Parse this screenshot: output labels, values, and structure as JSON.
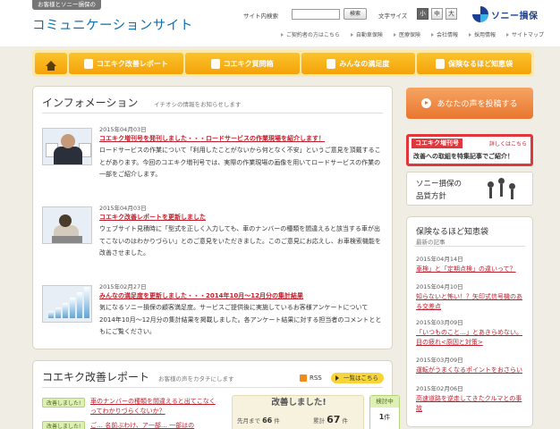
{
  "header": {
    "site_tag": "お客様とソニー損保の",
    "site_title": "コミュニケーションサイト",
    "search_label": "サイト内検索",
    "search_value": "",
    "search_button": "検索",
    "font_size_label": "文字サイズ",
    "font_sizes": [
      "小",
      "中",
      "大"
    ],
    "font_size_selected": "小",
    "brand_name": "ソニー損保",
    "utility_links": [
      "ご契約者の方はこちら",
      "自動車保険",
      "医療保険",
      "会社情報",
      "採用情報",
      "サイトマップ"
    ]
  },
  "nav": {
    "home_icon": "home-icon",
    "items": [
      {
        "label": "コエキク改善レポート",
        "icon": "report-icon"
      },
      {
        "label": "コエキク質問箱",
        "icon": "question-box-icon"
      },
      {
        "label": "みんなの満足度",
        "icon": "satisfaction-icon"
      },
      {
        "label": "保険なるほど知恵袋",
        "icon": "wisdom-bag-icon"
      }
    ]
  },
  "info": {
    "title": "インフォメーション",
    "subtitle": "イチオシの情報をお知らせします",
    "entries": [
      {
        "date": "2015年04月03日",
        "title": "コエキク増刊号を発刊しました・・・ロードサービスの作業現場を紹介します！",
        "body": "ロードサービスの作業について「利用したことがないから何となく不安」というご意見を頂戴することがあります。今回のコエキク増刊号では、実際の作業現場の画像を用いてロードサービスの作業の一部をご紹介します。"
      },
      {
        "date": "2015年04月03日",
        "title": "コエキク改善レポートを更新しました",
        "body": "ウェブサイト見積時に「型式を正しく入力しても、車のナンバーの種類を間違えると該当する車が出てこないのはわかりづらい」とのご意見をいただきました。このご意見にお応えし、お車検索機能を改善させました。"
      },
      {
        "date": "2015年02月27日",
        "title": "みんなの満足度を更新しました・・・2014年10月～12月分の集計結果",
        "body": "気になるソニー損保の顧客満足度。サービスご提供後に実施しているお客様アンケートについて2014年10月～12月分の集計結果を掲載しました。各アンケート結果に対する担当者のコメントとともにご覧ください。"
      }
    ]
  },
  "report": {
    "title": "コエキク改善レポート",
    "subtitle": "お客様の声をカタチにします",
    "rss_label": "RSS",
    "list_button": "一覧はこちら",
    "rows": [
      {
        "badge": "改善しました!",
        "link": "車のナンバーの種類を間違えると出てこなくってわかりづらくないか？"
      },
      {
        "badge": "改善しました!",
        "link": "ご… 名前ぶわけ、ア一部… 一部はの"
      }
    ],
    "stats_head": "改善しました!",
    "prev_month_label": "先月まで",
    "prev_month_value": "66",
    "count_unit": "件",
    "total_label": "累計",
    "total_value": "67",
    "review_label": "検討中",
    "review_value": "1",
    "review_unit": "件"
  },
  "sidebar": {
    "post_button": "あなたの声を投稿する",
    "kohyo_tag": "コエキク増刊号",
    "kohyo_more": "詳しくはこちら",
    "kohyo_text": "改善への取組を特集記事でご紹介！",
    "quality_line1": "ソニー損保の",
    "quality_line2": "品質方針",
    "chie_title": "保険なるほど知恵袋",
    "chie_subtitle": "最新の記事",
    "chie_items": [
      {
        "date": "2015年04月14日",
        "title": "車検」と「定期点検」の違いって？"
      },
      {
        "date": "2015年04月10日",
        "title": "知らないと怖い！？矢印式信号機のある交差点"
      },
      {
        "date": "2015年03月09日",
        "title": "「いつものこと…」とあきらめない。目の疲れ<原因と対策>"
      },
      {
        "date": "2015年03月09日",
        "title": "運転がうまくなるポイントをおさらい"
      },
      {
        "date": "2015年02月06日",
        "title": "高速道路を逆走してきたクルマとの事故"
      }
    ]
  }
}
